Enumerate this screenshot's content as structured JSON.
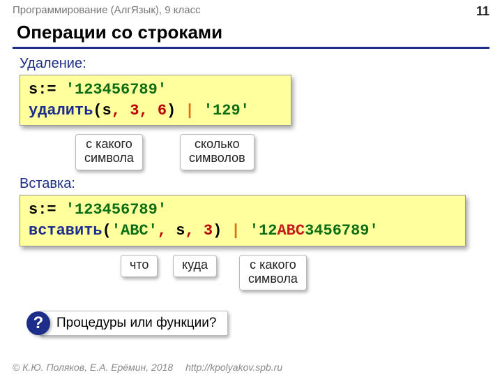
{
  "header": {
    "course": "Программирование (АлгЯзык), 9 класс",
    "page": "11"
  },
  "title": "Операции со строками",
  "delete": {
    "heading": "Удаление:",
    "line1": {
      "var": "s:= ",
      "str": "'123456789'"
    },
    "line2": {
      "kw": "удалить",
      "p1": "(",
      "a1": "s",
      "c1": ", ",
      "a2": "3",
      "c2": ", ",
      "a3": "6",
      "p2": ") ",
      "pipe": "|",
      "res": " '129'"
    },
    "callout1": "с какого\nсимвола",
    "callout2": "сколько\nсимволов"
  },
  "insert": {
    "heading": "Вставка:",
    "line1": {
      "var": "s:= ",
      "str": "'123456789'"
    },
    "line2": {
      "kw": "вставить",
      "p1": "(",
      "a1": "'ABC'",
      "c1": ", ",
      "a2": "s",
      "c2": ", ",
      "a3": "3",
      "p2": ") ",
      "pipe": "|",
      "res_pre": " '12",
      "res_abc": "ABC",
      "res_post": "3456789'"
    },
    "callout1": "что",
    "callout2": "куда",
    "callout3": "с какого\nсимвола"
  },
  "question": {
    "mark": "?",
    "text": "Процедуры или функции?"
  },
  "footer": {
    "copyright": "© К.Ю. Поляков, Е.А. Ерёмин, 2018",
    "url": "http://kpolyakov.spb.ru"
  }
}
